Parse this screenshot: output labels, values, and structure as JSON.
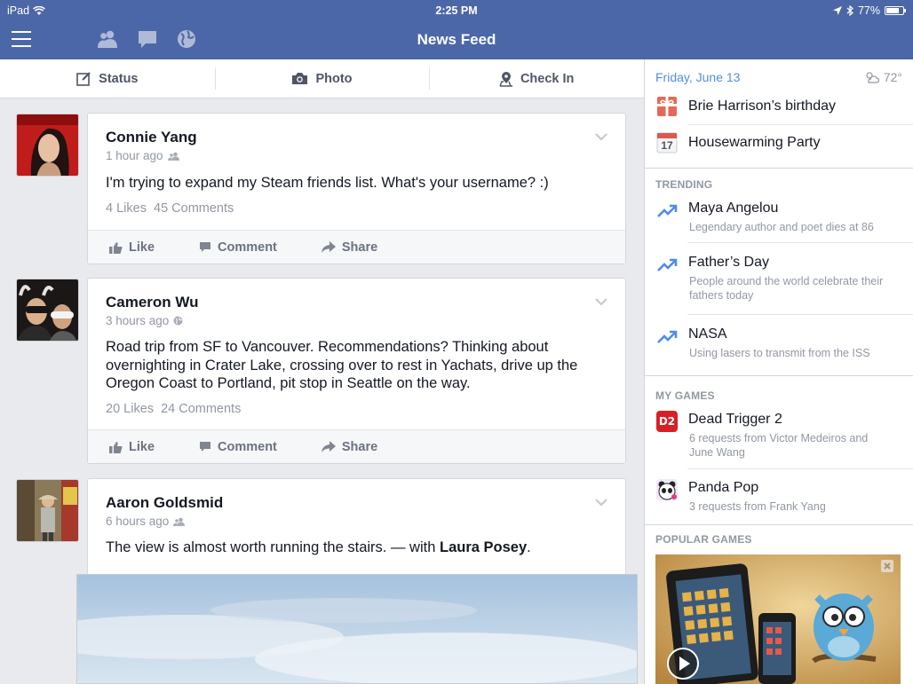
{
  "status_bar": {
    "device": "iPad",
    "time": "2:25 PM",
    "battery": "77%",
    "battery_level": 0.77
  },
  "nav": {
    "title": "News Feed"
  },
  "composer": {
    "status": "Status",
    "photo": "Photo",
    "check_in": "Check In"
  },
  "posts": [
    {
      "name": "Connie Yang",
      "time": "1 hour ago",
      "text": "I'm trying to expand my Steam friends list. What's your username? :)",
      "likes": "4 Likes",
      "comments": "45 Comments"
    },
    {
      "name": "Cameron Wu",
      "time": "3 hours ago",
      "text": "Road trip from SF to Vancouver. Recommendations? Thinking about overnighting in Crater Lake, crossing over to rest in Yachats, drive up the Oregon Coast to Portland, pit stop in Seattle on the way.",
      "likes": "20 Likes",
      "comments": "24 Comments"
    },
    {
      "name": "Aaron Goldsmid",
      "time": "6 hours ago",
      "text": "The view is almost worth running the stairs. — with ",
      "tag": "Laura Posey",
      "text_end": "."
    }
  ],
  "actions": {
    "like": "Like",
    "comment": "Comment",
    "share": "Share"
  },
  "sidebar": {
    "date": "Friday, June 13",
    "temp": "72°",
    "events": [
      {
        "title": "Brie Harrison’s birthday"
      },
      {
        "title": "Housewarming Party",
        "day": "17"
      }
    ],
    "trending_header": "TRENDING",
    "trending": [
      {
        "title": "Maya Angelou",
        "sub": "Legendary author and poet dies at 86"
      },
      {
        "title": "Father’s Day",
        "sub": "People around the world celebrate their fathers today"
      },
      {
        "title": "NASA",
        "sub": "Using lasers to transmit from the ISS"
      }
    ],
    "games_header": "MY GAMES",
    "games": [
      {
        "title": "Dead Trigger 2",
        "sub": "6 requests from Victor Medeiros and June Wang"
      },
      {
        "title": "Panda Pop",
        "sub": "3 requests from Frank Yang"
      }
    ],
    "popular_header": "POPULAR GAMES"
  },
  "colors": {
    "header": "#4b67a8",
    "link": "#3b5998",
    "trend": "#4f8ee2"
  }
}
